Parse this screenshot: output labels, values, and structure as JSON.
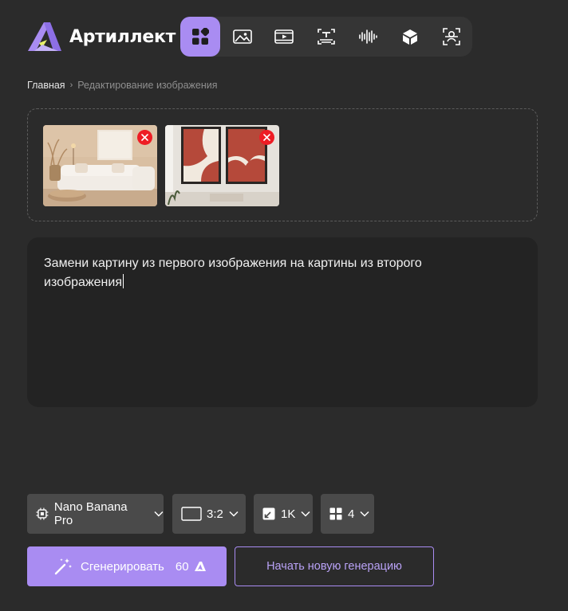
{
  "brand": {
    "name": "Артиллект",
    "accent": "#a98cf2"
  },
  "toolbar": {
    "items": [
      {
        "icon": "grid-apps-icon",
        "active": true
      },
      {
        "icon": "image-icon",
        "active": false
      },
      {
        "icon": "video-icon",
        "active": false
      },
      {
        "icon": "text-recognition-icon",
        "active": false
      },
      {
        "icon": "audio-wave-icon",
        "active": false
      },
      {
        "icon": "3d-cube-icon",
        "active": false
      },
      {
        "icon": "face-scan-icon",
        "active": false
      }
    ]
  },
  "breadcrumb": {
    "home": "Главная",
    "separator": "›",
    "current": "Редактирование изображения"
  },
  "uploads": {
    "remove_icon": "close-icon",
    "images": [
      {
        "name": "living-room-photo"
      },
      {
        "name": "abstract-paintings-photo"
      }
    ]
  },
  "prompt": {
    "value": "Замени картину из первого изображения на картины из второго изображения"
  },
  "options": {
    "model": {
      "icon": "chip-icon",
      "value": "Nano Banana Pro"
    },
    "aspect": {
      "icon": "rectangle-icon",
      "value": "3:2"
    },
    "resolution": {
      "icon": "resize-icon",
      "value": "1K"
    },
    "count": {
      "icon": "grid-icon",
      "value": "4"
    }
  },
  "actions": {
    "generate_label": "Сгенерировать",
    "generate_cost": "60",
    "generate_icon": "magic-wand-icon",
    "cost_icon": "brand-token-icon",
    "new_label": "Начать новую генерацию"
  }
}
